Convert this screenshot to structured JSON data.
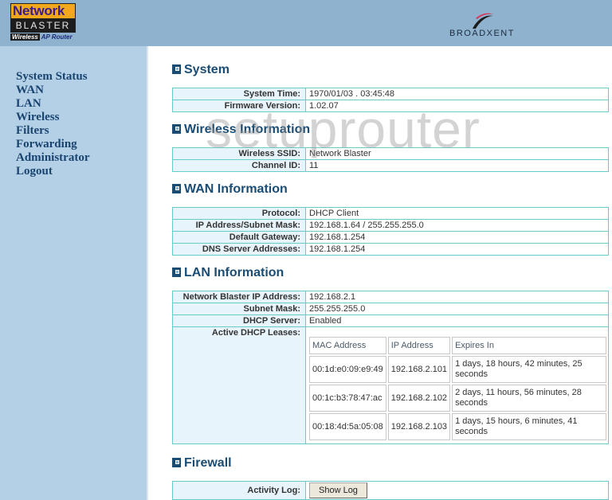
{
  "header": {
    "logo": {
      "line1": "Network",
      "line2": "BLASTER",
      "line3_tag": "Wireless",
      "line3_rest": " AP Router"
    },
    "brand": "BROADXENT",
    "colors": {
      "header_bg": "#8fb3cf",
      "sidebar_bg": "#b3d0e6",
      "accent": "#1a4c74",
      "table_border": "#66cccc",
      "label_bg": "#e8f4fb"
    }
  },
  "sidebar": {
    "items": [
      {
        "label": "System Status"
      },
      {
        "label": "WAN"
      },
      {
        "label": "LAN"
      },
      {
        "label": "Wireless"
      },
      {
        "label": "Filters"
      },
      {
        "label": "Forwarding"
      },
      {
        "label": "Administrator"
      },
      {
        "label": "Logout"
      }
    ]
  },
  "watermark": "setuprouter",
  "system": {
    "title": "System",
    "rows": [
      {
        "label": "System Time:",
        "value": "1970/01/03 . 03:45:48"
      },
      {
        "label": "Firmware Version:",
        "value": "1.02.07"
      }
    ]
  },
  "wireless": {
    "title": "Wireless Information",
    "rows": [
      {
        "label": "Wireless SSID:",
        "value": "Network Blaster"
      },
      {
        "label": "Channel ID:",
        "value": "11"
      }
    ]
  },
  "wan": {
    "title": "WAN Information",
    "rows": [
      {
        "label": "Protocol:",
        "value": "DHCP Client"
      },
      {
        "label": "IP Address/Subnet Mask:",
        "value": "192.168.1.64 / 255.255.255.0"
      },
      {
        "label": "Default Gateway:",
        "value": "192.168.1.254"
      },
      {
        "label": "DNS Server Addresses:",
        "value": "192.168.1.254"
      }
    ]
  },
  "lan": {
    "title": "LAN Information",
    "rows": [
      {
        "label": "Network Blaster IP Address:",
        "value": "192.168.2.1"
      },
      {
        "label": "Subnet Mask:",
        "value": "255.255.255.0"
      },
      {
        "label": "DHCP Server:",
        "value": "Enabled"
      }
    ],
    "leases_label": "Active DHCP Leases:",
    "leases": {
      "headers": [
        "MAC Address",
        "IP Address",
        "Expires In"
      ],
      "rows": [
        [
          "00:1d:e0:09:e9:49",
          "192.168.2.101",
          "1 days, 18 hours, 42 minutes, 25 seconds"
        ],
        [
          "00:1c:b3:78:47:ac",
          "192.168.2.102",
          "2 days, 11 hours, 56 minutes, 28 seconds"
        ],
        [
          "00:18:4d:5a:05:08",
          "192.168.2.103",
          "1 days, 15 hours, 6 minutes, 41 seconds"
        ]
      ]
    }
  },
  "firewall": {
    "title": "Firewall",
    "activity_label": "Activity Log:",
    "show_log_button": "Show Log"
  }
}
